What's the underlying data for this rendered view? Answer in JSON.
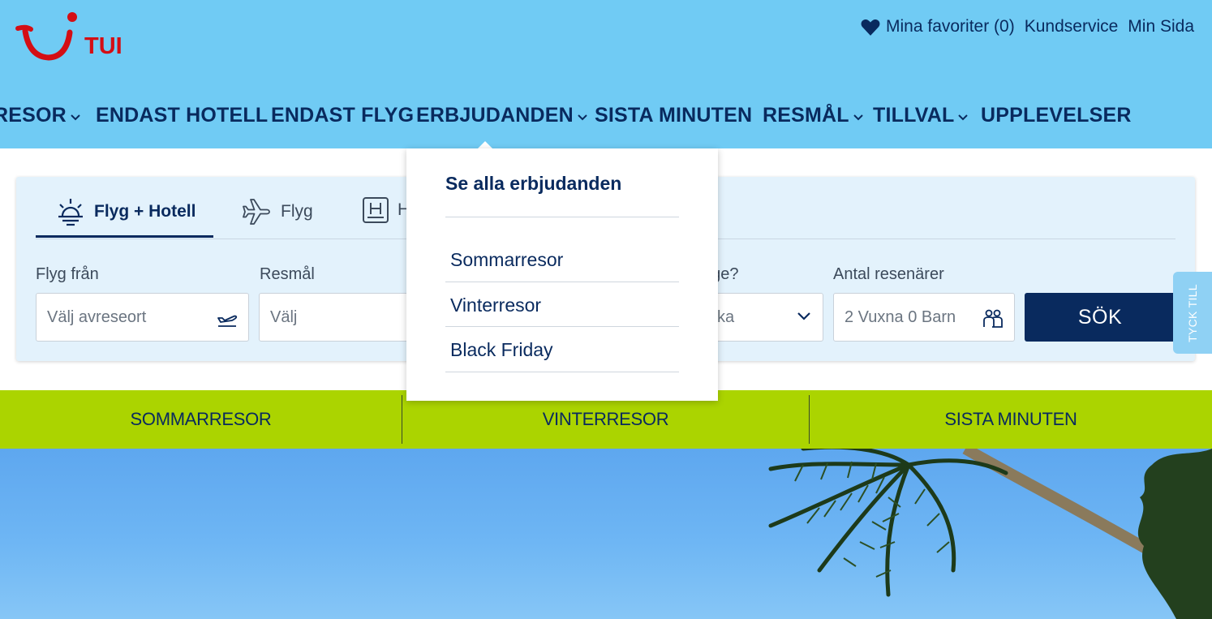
{
  "brand": {
    "name": "TUI",
    "color": "#d40e14"
  },
  "utility_nav": {
    "favorites": "Mina favoriter (0)",
    "customer_service": "Kundservice",
    "my_page": "Min Sida"
  },
  "main_nav": [
    {
      "label": "RESOR",
      "has_dropdown": true
    },
    {
      "label": "ENDAST HOTELL",
      "has_dropdown": false
    },
    {
      "label": "ENDAST FLYG",
      "has_dropdown": false
    },
    {
      "label": "ERBJUDANDEN",
      "has_dropdown": true
    },
    {
      "label": "SISTA MINUTEN",
      "has_dropdown": false
    },
    {
      "label": "RESMÅL",
      "has_dropdown": true
    },
    {
      "label": "TILLVAL",
      "has_dropdown": true
    },
    {
      "label": "UPPLEVELSER",
      "has_dropdown": false
    }
  ],
  "search": {
    "tabs": [
      {
        "label": "Flyg + Hotell",
        "icon": "sun-horizon-icon",
        "active": true
      },
      {
        "label": "Flyg",
        "icon": "plane-icon",
        "active": false
      },
      {
        "label": "H",
        "icon": "hotel-icon",
        "active": false
      }
    ],
    "fields": {
      "from": {
        "label": "Flyg från",
        "placeholder": "Välj avreseort"
      },
      "destination": {
        "label": "Resmål",
        "placeholder": "Välj"
      },
      "duration": {
        "label": "nge?",
        "value": "cka"
      },
      "travellers": {
        "label": "Antal resenärer",
        "value": "2 Vuxna 0 Barn"
      }
    },
    "submit_label": "SÖK"
  },
  "feedback_label": "TYCK TILL",
  "quick_links": [
    "SOMMARRESOR",
    "VINTERRESOR",
    "SISTA MINUTEN"
  ],
  "dropdown": {
    "title": "Se alla erbjudanden",
    "items": [
      "Sommarresor",
      "Vinterresor",
      "Black Friday"
    ]
  },
  "colors": {
    "header_bg": "#70cbf4",
    "navy": "#092a5e",
    "quick_bar": "#abd400",
    "search_bg": "#e3f2fc"
  }
}
